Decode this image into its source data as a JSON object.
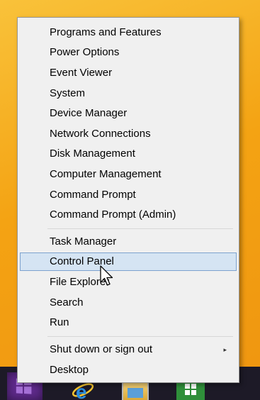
{
  "menu": {
    "items": [
      {
        "label": "Programs and Features"
      },
      {
        "label": "Power Options"
      },
      {
        "label": "Event Viewer"
      },
      {
        "label": "System"
      },
      {
        "label": "Device Manager"
      },
      {
        "label": "Network Connections"
      },
      {
        "label": "Disk Management"
      },
      {
        "label": "Computer Management"
      },
      {
        "label": "Command Prompt"
      },
      {
        "label": "Command Prompt (Admin)"
      },
      {
        "label": "Task Manager"
      },
      {
        "label": "Control Panel",
        "highlighted": true
      },
      {
        "label": "File Explorer"
      },
      {
        "label": "Search"
      },
      {
        "label": "Run"
      },
      {
        "label": "Shut down or sign out",
        "has_submenu": true,
        "submenu_glyph": "▸"
      },
      {
        "label": "Desktop"
      }
    ],
    "hover_color": "#d5e4f3"
  },
  "taskbar": {
    "icons": [
      "start-icon",
      "internet-explorer-icon",
      "file-explorer-icon",
      "store-icon"
    ],
    "start_color": "#5f2a8c"
  }
}
